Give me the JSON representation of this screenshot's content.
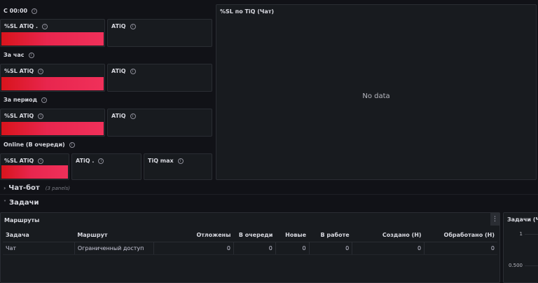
{
  "groups": {
    "g1": "С 00:00",
    "g2": "За час",
    "g3": "За период",
    "g4": "Online (В очереди)"
  },
  "stats": {
    "sl_a1": "%SL ATiQ .",
    "atiq_1": "ATiQ",
    "sl_2": "%SL ATiQ",
    "atiq_2": "ATiQ",
    "sl_3": "%SL ATiQ",
    "atiq_3": "ATiQ",
    "sl_4": "%SL ATiQ",
    "atiq_4": "ATiQ .",
    "tiq_max": "TiQ max"
  },
  "chart_panel": {
    "title": "%SL по TiQ (Чат)",
    "empty_text": "No data"
  },
  "rows": {
    "chatbot": {
      "title": "Чат-бот",
      "count": "(3 panels)"
    },
    "tasks": {
      "title": "Задачи"
    }
  },
  "routes_panel": {
    "title": "Маршруты",
    "menu_icon": "⋮",
    "columns": [
      "Задача",
      "Маршрут",
      "Отложены",
      "В очереди",
      "Новые",
      "В работе",
      "Создано (Н)",
      "Обработано (Н)"
    ],
    "rows": [
      [
        "Чат",
        "Ограниченный доступ",
        "0",
        "0",
        "0",
        "0",
        "0",
        "0"
      ]
    ]
  },
  "side_panel": {
    "title": "Задачи (Ча",
    "y_ticks": [
      "1",
      "0.500"
    ]
  },
  "colors": {
    "bar_start": "#d8141c",
    "bar_end": "#f0305a",
    "background": "#111217",
    "panel": "#181b1f"
  }
}
